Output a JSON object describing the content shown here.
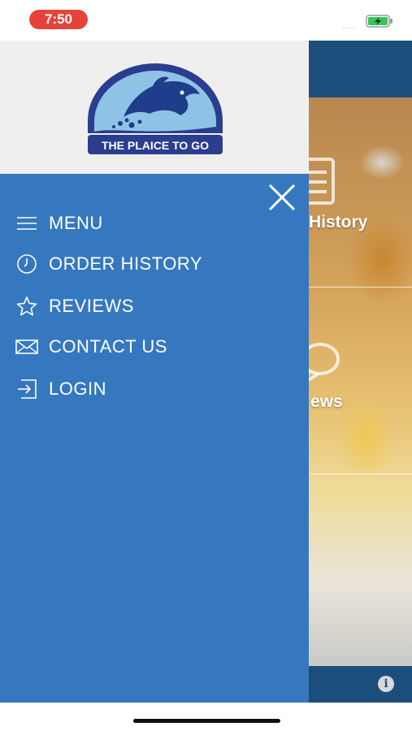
{
  "status_bar": {
    "time": "7:50",
    "signal": "....",
    "time_pill_color": "#e5433a",
    "battery_color": "#34c759",
    "battery_state": "charging"
  },
  "drawer": {
    "logo_text": "THE PLAICE TO GO",
    "background_color": "#3578bf",
    "header_color": "#efefef",
    "menu_items": [
      {
        "label": "MENU",
        "icon": "hamburger-icon"
      },
      {
        "label": "ORDER HISTORY",
        "icon": "clock-icon"
      },
      {
        "label": "REVIEWS",
        "icon": "star-icon"
      },
      {
        "label": "CONTACT US",
        "icon": "envelope-icon"
      },
      {
        "label": "LOGIN",
        "icon": "login-icon"
      }
    ],
    "close_icon": "close-icon"
  },
  "background_app": {
    "header_color": "#1c4e7c",
    "partial_label_1": "History",
    "partial_label_2": "ews",
    "info_icon": "info-icon",
    "info_glyph": "i"
  }
}
